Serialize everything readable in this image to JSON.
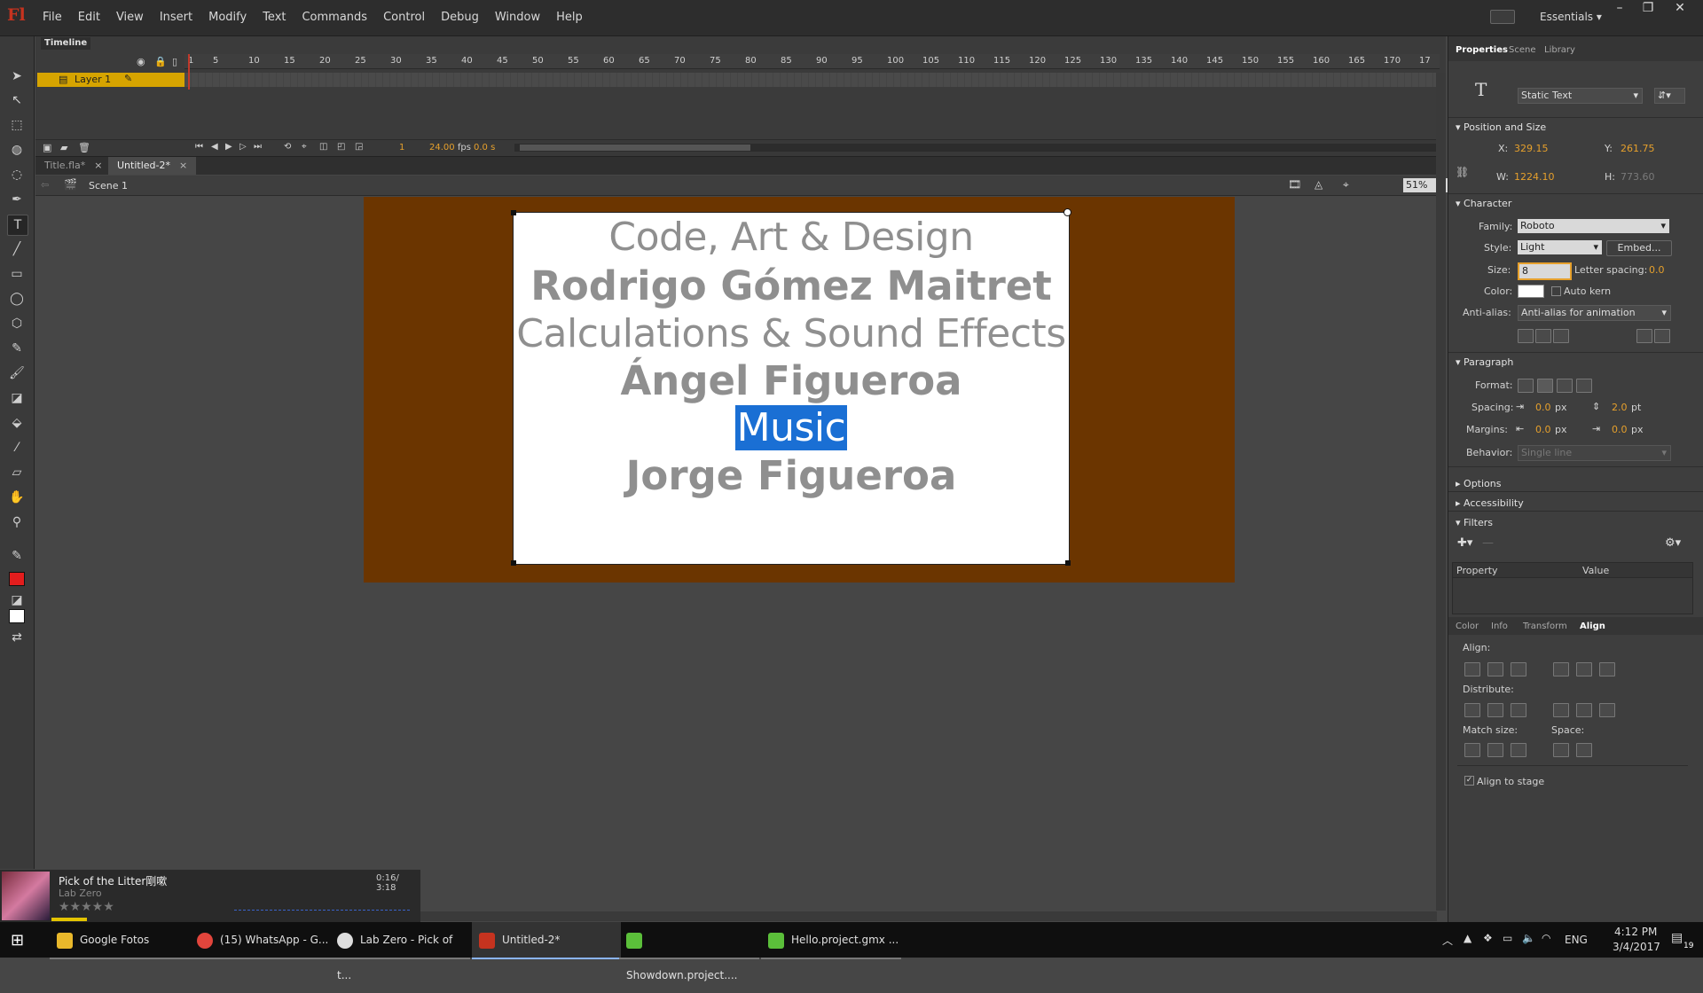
{
  "app": {
    "logo": "Fl",
    "menu": [
      "File",
      "Edit",
      "View",
      "Insert",
      "Modify",
      "Text",
      "Commands",
      "Control",
      "Debug",
      "Window",
      "Help"
    ],
    "workspace": "Essentials",
    "window_buttons": [
      "–",
      "❐",
      "✕"
    ]
  },
  "timeline": {
    "tab": "Timeline",
    "ruler": [
      "1",
      "5",
      "10",
      "15",
      "20",
      "25",
      "30",
      "35",
      "40",
      "45",
      "50",
      "55",
      "60",
      "65",
      "70",
      "75",
      "80",
      "85",
      "90",
      "95",
      "100",
      "105",
      "110",
      "115",
      "120",
      "125",
      "130",
      "135",
      "140",
      "145",
      "150",
      "155",
      "160",
      "165",
      "170",
      "17"
    ],
    "layer": "Layer 1",
    "frame": "1",
    "fps": "24.00",
    "fps_unit": "fps",
    "time": "0.0 s"
  },
  "doc_tabs": [
    {
      "label": "Title.fla*",
      "active": false
    },
    {
      "label": "Untitled-2*",
      "active": true
    }
  ],
  "edit_bar": {
    "scene": "Scene 1",
    "zoom": "51%"
  },
  "stage": {
    "background": "#6b3500",
    "lines": [
      {
        "text": "Code, Art & Design",
        "style": "light"
      },
      {
        "text": "Rodrigo Gómez Maitret",
        "style": "bold"
      },
      {
        "text": "Calculations & Sound Effects",
        "style": "light"
      },
      {
        "text": "Ángel Figueroa",
        "style": "bold"
      },
      {
        "text": "Music",
        "style": "light",
        "selected": true
      },
      {
        "text": "Jorge Figueroa",
        "style": "bold"
      }
    ]
  },
  "properties": {
    "tabs": [
      "Properties",
      "Scene",
      "Library"
    ],
    "text_type": "Static Text",
    "position_size": {
      "title": "Position and Size",
      "x_label": "X:",
      "x": "329.15",
      "y_label": "Y:",
      "y": "261.75",
      "w_label": "W:",
      "w": "1224.10",
      "h_label": "H:",
      "h": "773.60"
    },
    "character": {
      "title": "Character",
      "family_label": "Family:",
      "family": "Roboto",
      "style_label": "Style:",
      "style": "Light",
      "embed": "Embed...",
      "size_label": "Size:",
      "size": "8",
      "letter_spacing_label": "Letter spacing:",
      "letter_spacing": "0.0",
      "color_label": "Color:",
      "auto_kern": "Auto kern",
      "anti_alias_label": "Anti-alias:",
      "anti_alias": "Anti-alias for animation"
    },
    "paragraph": {
      "title": "Paragraph",
      "format_label": "Format:",
      "spacing_label": "Spacing:",
      "spacing1": "0.0",
      "spacing1_unit": "px",
      "spacing2": "2.0",
      "spacing2_unit": "pt",
      "margins_label": "Margins:",
      "margin1": "0.0",
      "margin1_unit": "px",
      "margin2": "0.0",
      "margin2_unit": "px",
      "behavior_label": "Behavior:",
      "behavior": "Single line"
    },
    "collapsed": [
      "Options",
      "Accessibility"
    ],
    "filters": {
      "title": "Filters",
      "col_property": "Property",
      "col_value": "Value"
    }
  },
  "align_panel": {
    "tabs": [
      "Color",
      "Info",
      "Transform",
      "Align"
    ],
    "align_label": "Align:",
    "distribute_label": "Distribute:",
    "match_size_label": "Match size:",
    "space_label": "Space:",
    "align_to_stage": "Align to stage"
  },
  "media": {
    "title": "Pick of the Litter剛嗽",
    "artist": "Lab Zero",
    "time": "0:16/ 3:18",
    "rating_stars": "★★★★★"
  },
  "taskbar": {
    "items": [
      "Google Fotos",
      "(15) WhatsApp - G...",
      "Lab Zero - Pick of t...",
      "Untitled-2*",
      "Showdown.project....",
      "Hello.project.gmx ..."
    ],
    "lang": "ENG",
    "time": "4:12 PM",
    "date": "3/4/2017",
    "notif_count": "19"
  }
}
